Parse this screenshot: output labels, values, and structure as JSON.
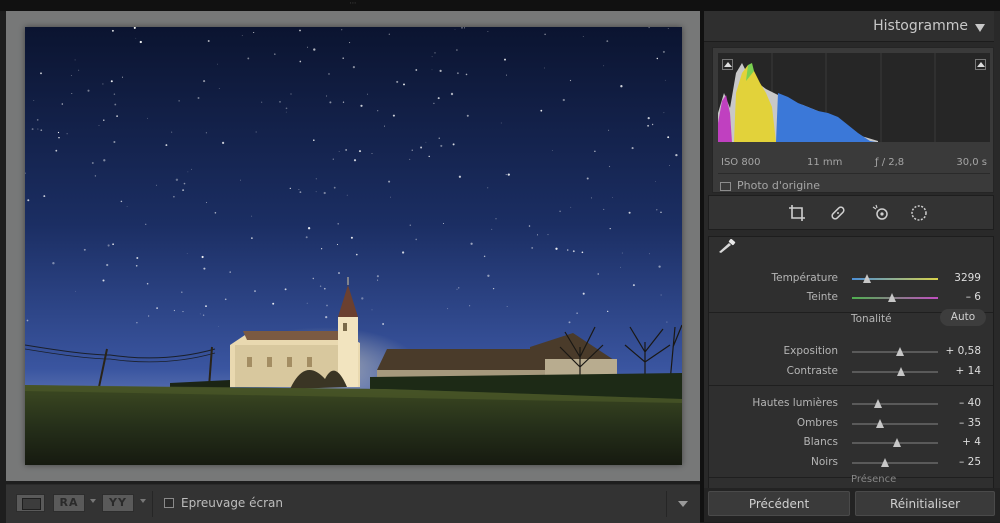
{
  "histogram": {
    "title": "Histogramme",
    "exif": {
      "iso": "ISO 800",
      "focal": "11 mm",
      "aperture": "ƒ / 2,8",
      "shutter": "30,0 s"
    },
    "original_photo_label": "Photo d'origine"
  },
  "basic": {
    "white_balance": [
      {
        "label": "Température",
        "value": "3299",
        "position": 0.18
      },
      {
        "label": "Teinte",
        "value": "– 6",
        "position": 0.47
      }
    ],
    "tonal_label": "Tonalité",
    "auto_label": "Auto",
    "tone": [
      {
        "label": "Exposition",
        "value": "+ 0,58",
        "position": 0.56
      },
      {
        "label": "Contraste",
        "value": "+ 14",
        "position": 0.57
      }
    ],
    "tone2": [
      {
        "label": "Hautes lumières",
        "value": "– 40",
        "position": 0.3
      },
      {
        "label": "Ombres",
        "value": "– 35",
        "position": 0.33
      },
      {
        "label": "Blancs",
        "value": "+ 4",
        "position": 0.52
      },
      {
        "label": "Noirs",
        "value": "– 25",
        "position": 0.38
      }
    ],
    "presence_label": "Présence"
  },
  "toolbar": {
    "ra_label": "RA",
    "yy_label": "YY",
    "soft_proof_label": "Epreuvage écran"
  },
  "buttons": {
    "previous_label": "Précédent",
    "reset_label": "Réinitialiser"
  },
  "colors": {
    "accent_slider_temp_start": "#4c8fd6",
    "accent_slider_temp_end": "#d8d24a",
    "tint_start": "#4fb04f",
    "tint_end": "#c04ec0"
  }
}
